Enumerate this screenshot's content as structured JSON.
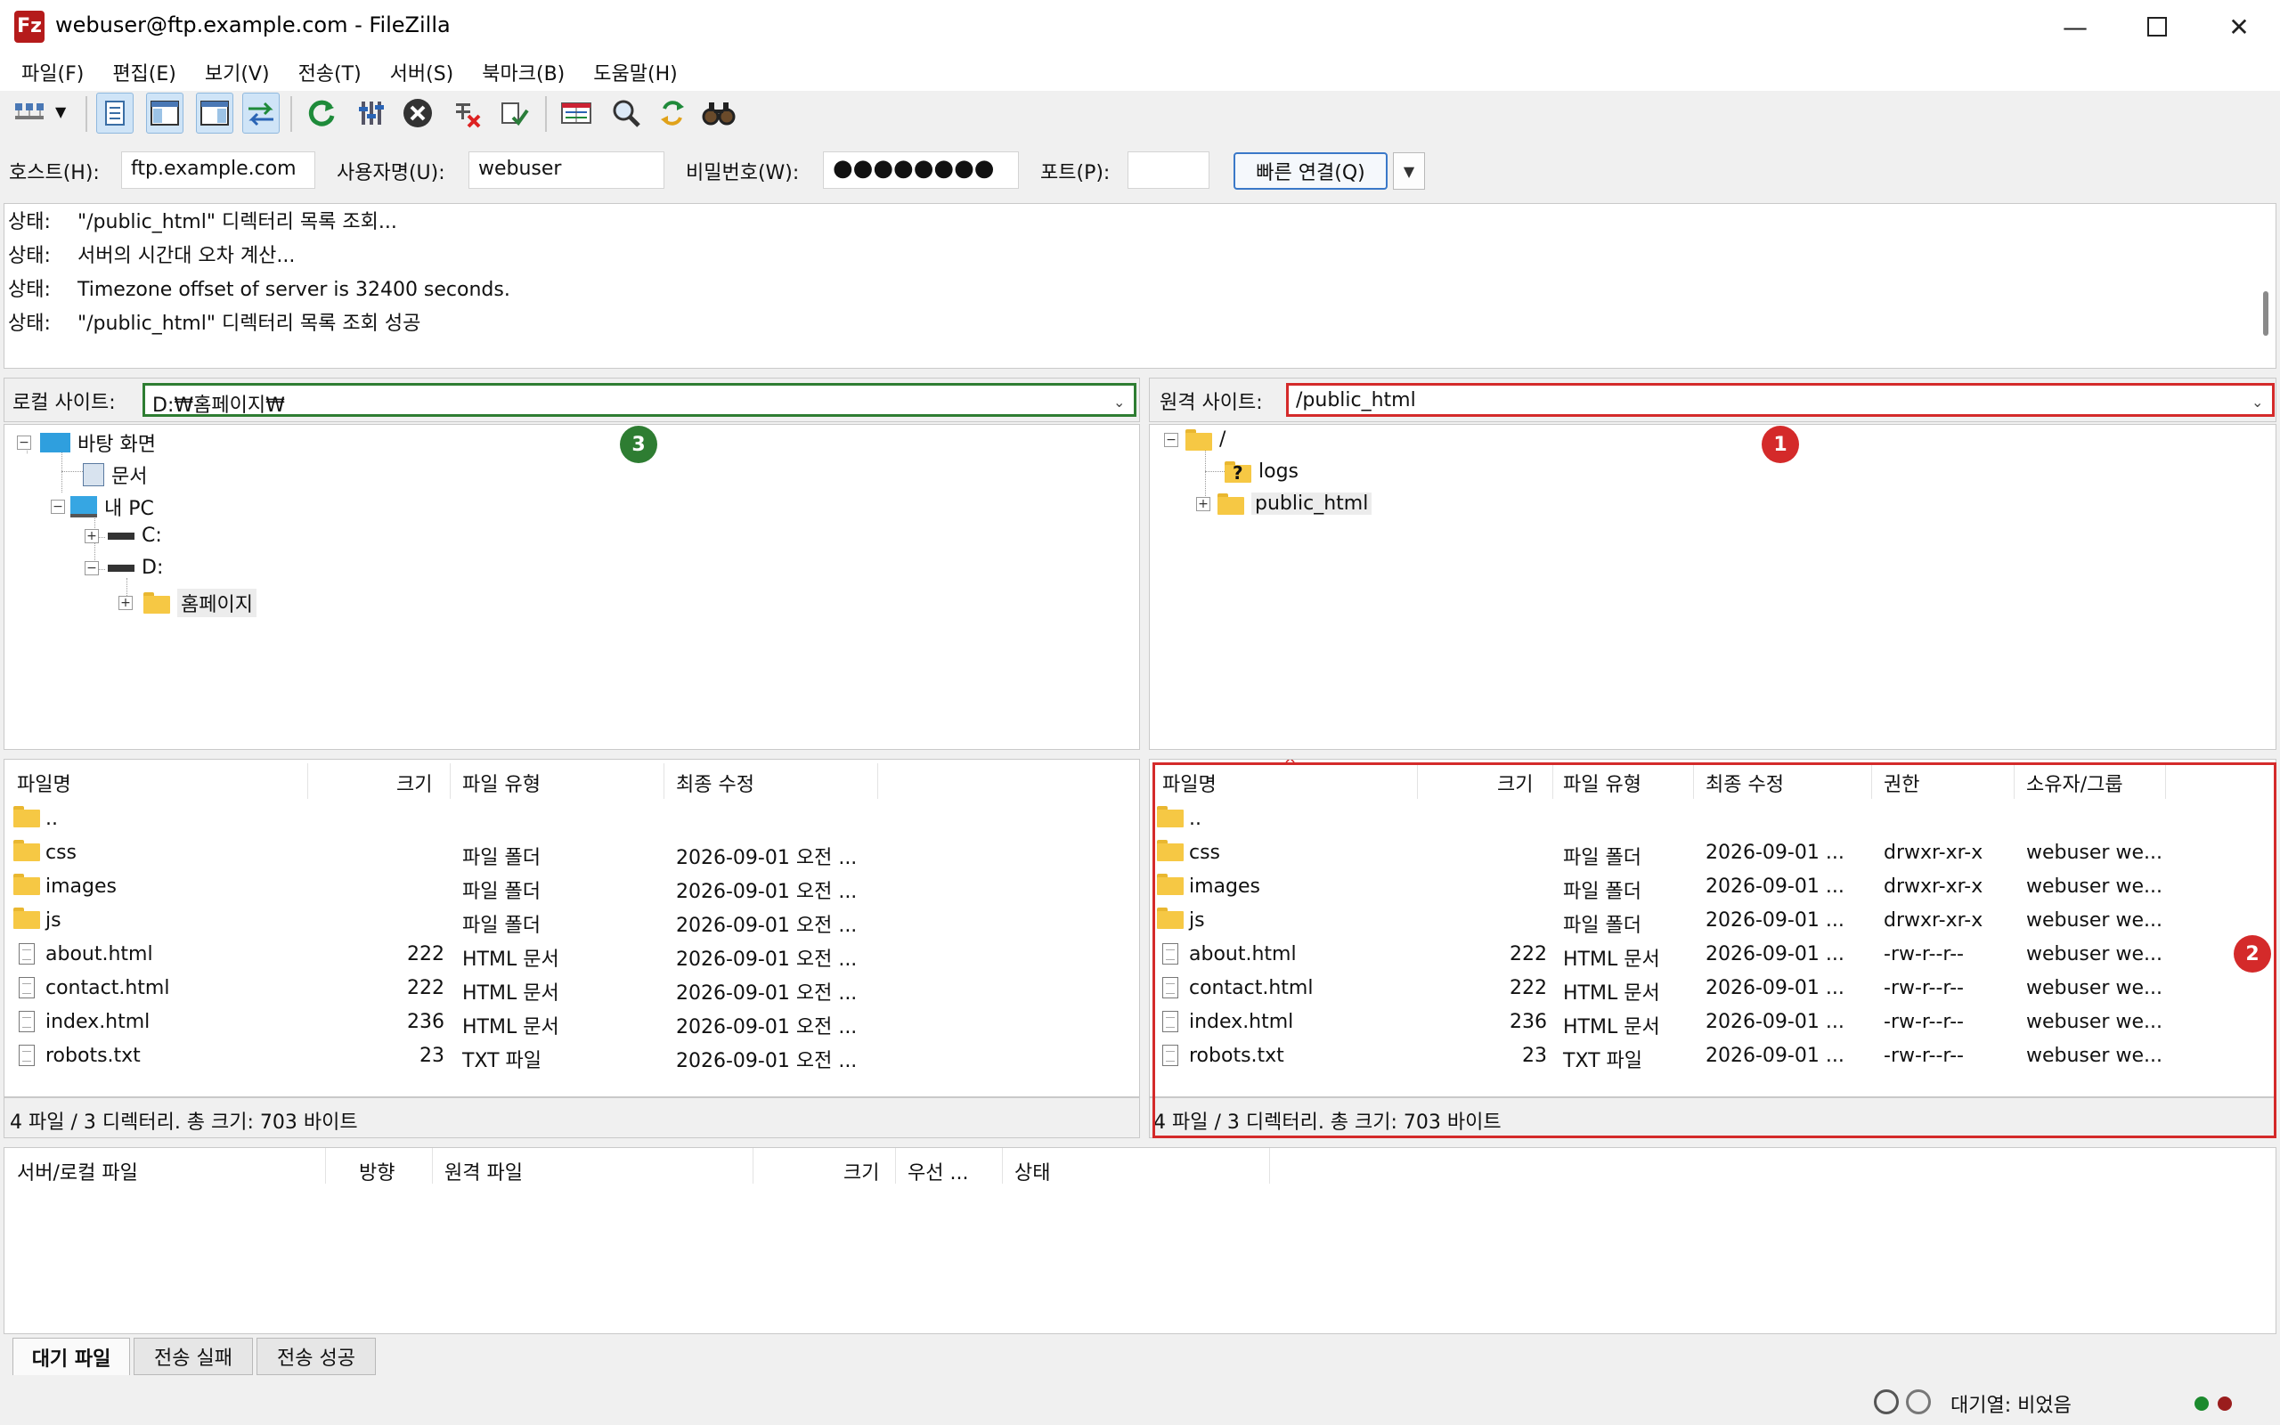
{
  "window": {
    "title": "webuser@ftp.example.com - FileZilla",
    "icon_text": "Fz"
  },
  "menu": [
    "파일(F)",
    "편집(E)",
    "보기(V)",
    "전송(T)",
    "서버(S)",
    "북마크(B)",
    "도움말(H)"
  ],
  "toolbar": {
    "icons": [
      "site-manager-icon",
      "toggle-log-icon",
      "toggle-local-tree-icon",
      "toggle-remote-tree-icon",
      "toggle-queue-icon",
      "refresh-icon",
      "filter-icon",
      "cancel-icon",
      "disconnect-icon",
      "reconnect-icon",
      "directory-compare-icon",
      "sync-browse-icon",
      "process-queue-icon",
      "search-icon"
    ]
  },
  "quickconnect": {
    "host_label": "호스트(H):",
    "host_value": "ftp.example.com",
    "user_label": "사용자명(U):",
    "user_value": "webuser",
    "pass_label": "비밀번호(W):",
    "pass_value": "●●●●●●●●",
    "port_label": "포트(P):",
    "port_value": "",
    "connect_label": "빠른 연결(Q)"
  },
  "log": [
    {
      "type": "상태:",
      "msg": "\"/public_html\" 디렉터리 목록 조회..."
    },
    {
      "type": "상태:",
      "msg": "서버의 시간대 오차 계산..."
    },
    {
      "type": "상태:",
      "msg": "Timezone offset of server is 32400 seconds."
    },
    {
      "type": "상태:",
      "msg": "\"/public_html\" 디렉터리 목록 조회 성공"
    }
  ],
  "local": {
    "site_label": "로컬 사이트:",
    "path": "D:₩홈페이지₩",
    "tree": [
      "바탕 화면",
      "문서",
      "내 PC",
      "C:",
      "D:",
      "홈페이지"
    ],
    "columns": [
      "파일명",
      "크기",
      "파일 유형",
      "최종 수정"
    ],
    "files": [
      {
        "name": "..",
        "size": "",
        "type": "",
        "modified": ""
      },
      {
        "name": "css",
        "size": "",
        "type": "파일 폴더",
        "modified": "2026-09-01 오전 ..."
      },
      {
        "name": "images",
        "size": "",
        "type": "파일 폴더",
        "modified": "2026-09-01 오전 ..."
      },
      {
        "name": "js",
        "size": "",
        "type": "파일 폴더",
        "modified": "2026-09-01 오전 ..."
      },
      {
        "name": "about.html",
        "size": "222",
        "type": "HTML 문서",
        "modified": "2026-09-01 오전 ..."
      },
      {
        "name": "contact.html",
        "size": "222",
        "type": "HTML 문서",
        "modified": "2026-09-01 오전 ..."
      },
      {
        "name": "index.html",
        "size": "236",
        "type": "HTML 문서",
        "modified": "2026-09-01 오전 ..."
      },
      {
        "name": "robots.txt",
        "size": "23",
        "type": "TXT 파일",
        "modified": "2026-09-01 오전 ..."
      }
    ],
    "status": "4 파일 / 3 디렉터리. 총 크기: 703 바이트"
  },
  "remote": {
    "site_label": "원격 사이트:",
    "path": "/public_html",
    "tree": [
      "/",
      "logs",
      "public_html"
    ],
    "unknown_glyph": "?",
    "columns": [
      "파일명",
      "크기",
      "파일 유형",
      "최종 수정",
      "권한",
      "소유자/그룹"
    ],
    "files": [
      {
        "name": "..",
        "size": "",
        "type": "",
        "modified": "",
        "perm": "",
        "owner": ""
      },
      {
        "name": "css",
        "size": "",
        "type": "파일 폴더",
        "modified": "2026-09-01 ...",
        "perm": "drwxr-xr-x",
        "owner": "webuser we..."
      },
      {
        "name": "images",
        "size": "",
        "type": "파일 폴더",
        "modified": "2026-09-01 ...",
        "perm": "drwxr-xr-x",
        "owner": "webuser we..."
      },
      {
        "name": "js",
        "size": "",
        "type": "파일 폴더",
        "modified": "2026-09-01 ...",
        "perm": "drwxr-xr-x",
        "owner": "webuser we..."
      },
      {
        "name": "about.html",
        "size": "222",
        "type": "HTML 문서",
        "modified": "2026-09-01 ...",
        "perm": "-rw-r--r--",
        "owner": "webuser we..."
      },
      {
        "name": "contact.html",
        "size": "222",
        "type": "HTML 문서",
        "modified": "2026-09-01 ...",
        "perm": "-rw-r--r--",
        "owner": "webuser we..."
      },
      {
        "name": "index.html",
        "size": "236",
        "type": "HTML 문서",
        "modified": "2026-09-01 ...",
        "perm": "-rw-r--r--",
        "owner": "webuser we..."
      },
      {
        "name": "robots.txt",
        "size": "23",
        "type": "TXT 파일",
        "modified": "2026-09-01 ...",
        "perm": "-rw-r--r--",
        "owner": "webuser we..."
      }
    ],
    "status": "4 파일 / 3 디렉터리. 총 크기: 703 바이트"
  },
  "queue": {
    "columns": [
      "서버/로컬 파일",
      "방향",
      "원격 파일",
      "크기",
      "우선 ...",
      "상태"
    ],
    "tabs": [
      "대기 파일",
      "전송 실패",
      "전송 성공"
    ],
    "status": "대기열: 비었음"
  },
  "annotations": [
    {
      "label": "1",
      "color": "#d42a2a"
    },
    {
      "label": "2",
      "color": "#d42a2a"
    },
    {
      "label": "3",
      "color": "#2e7d32"
    }
  ]
}
